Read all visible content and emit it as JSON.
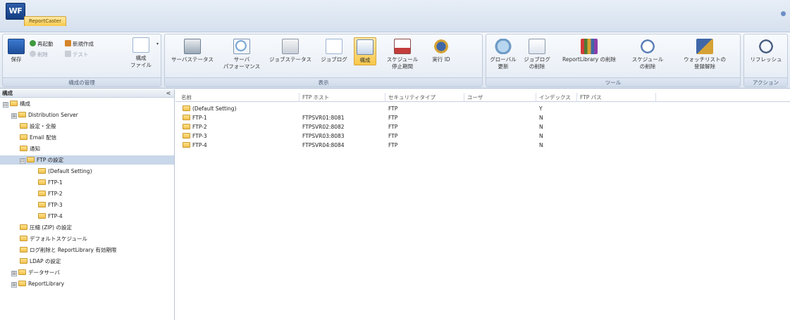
{
  "app": {
    "logo": "WF",
    "tab": "ReportCaster"
  },
  "ribbon": {
    "groups": [
      {
        "label": "構成の管理"
      },
      {
        "label": "表示"
      },
      {
        "label": "ツール"
      },
      {
        "label": "アクション"
      }
    ],
    "manage": {
      "save": "保存",
      "restart": "再起動",
      "new": "新規作成",
      "delete": "削除",
      "test": "テスト",
      "config_file": "構成\nファイル"
    },
    "view": {
      "server_status": "サーバステータス",
      "server_performance": "サーバ\nパフォーマンス",
      "job_status": "ジョブステータス",
      "job_log": "ジョブログ",
      "config": "構成",
      "schedule_suspend": "スケジュール\n停止期間",
      "run_id": "実行 ID"
    },
    "tools": {
      "global_update": "グローバル\n更新",
      "delete_job_log": "ジョブログ\nの削除",
      "delete_reportlibrary": "ReportLibrary の削除",
      "delete_schedule": "スケジュール\nの削除",
      "watchlist_unregister": "ウォッチリストの\n登録解除"
    },
    "actions": {
      "refresh": "リフレッシュ"
    }
  },
  "tree": {
    "header": "構成",
    "collapse": "<",
    "nodes": [
      {
        "label": "構成",
        "toggle": "⊟"
      },
      {
        "label": "Distribution Server",
        "toggle": "⊞"
      },
      {
        "label": "設定・全般"
      },
      {
        "label": "Email 配信"
      },
      {
        "label": "通知"
      },
      {
        "label": "FTP の設定",
        "toggle": "⊟"
      },
      {
        "label": "(Default Setting)"
      },
      {
        "label": "FTP-1"
      },
      {
        "label": "FTP-2"
      },
      {
        "label": "FTP-3"
      },
      {
        "label": "FTP-4"
      },
      {
        "label": "圧縮 (ZIP) の設定"
      },
      {
        "label": "デフォルトスケジュール"
      },
      {
        "label": "ログ削除と ReportLibrary 有効期限"
      },
      {
        "label": "LDAP の設定"
      },
      {
        "label": "データサーバ",
        "toggle": "⊞"
      },
      {
        "label": "ReportLibrary",
        "toggle": "⊞"
      }
    ]
  },
  "list": {
    "columns": [
      "名前",
      "FTP ホスト",
      "セキュリティタイプ",
      "ユーザ",
      "インデックス",
      "FTP パス"
    ],
    "rows": [
      {
        "name": "(Default Setting)",
        "host": "",
        "security": "FTP",
        "user": "",
        "index": "Y",
        "path": ""
      },
      {
        "name": "FTP-1",
        "host": "FTPSVR01:8081",
        "security": "FTP",
        "user": "",
        "index": "N",
        "path": ""
      },
      {
        "name": "FTP-2",
        "host": "FTPSVR02:8082",
        "security": "FTP",
        "user": "",
        "index": "N",
        "path": ""
      },
      {
        "name": "FTP-3",
        "host": "FTPSVR03:8083",
        "security": "FTP",
        "user": "",
        "index": "N",
        "path": ""
      },
      {
        "name": "FTP-4",
        "host": "FTPSVR04:8084",
        "security": "FTP",
        "user": "",
        "index": "N",
        "path": ""
      }
    ]
  }
}
